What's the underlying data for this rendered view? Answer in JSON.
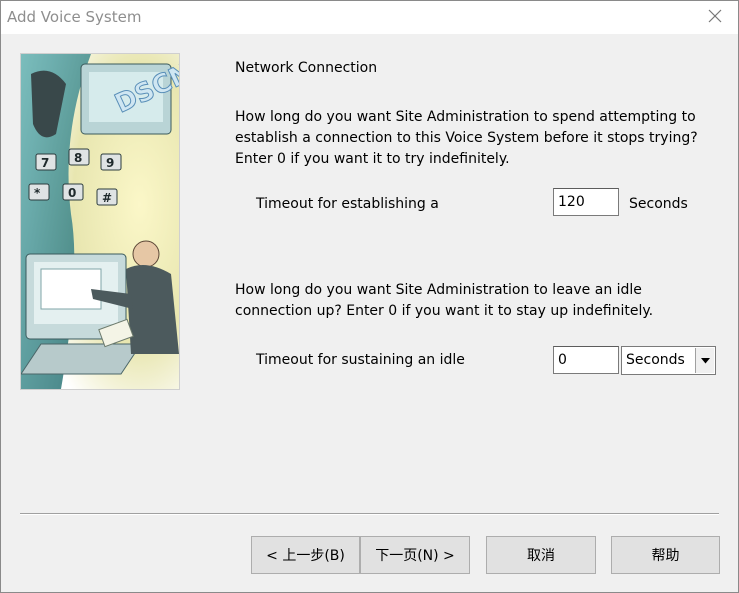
{
  "window": {
    "title": "Add Voice System"
  },
  "page": {
    "heading": "Network Connection",
    "para1": "How long do you want Site Administration to spend attempting to establish a connection to this Voice System before it stops trying?  Enter 0 if you want it to try indefinitely.",
    "timeout_establish": {
      "label": "Timeout for establishing a",
      "value": "120",
      "unit": "Seconds"
    },
    "para2": "How long do you want Site Administration to leave an idle connection up? Enter 0 if you want it to stay up indefinitely.",
    "timeout_idle": {
      "label": "Timeout for sustaining an idle",
      "value": "0",
      "unit_selected": "Seconds"
    }
  },
  "buttons": {
    "back": "< 上一步(B)",
    "next": "下一页(N) >",
    "cancel": "取消",
    "help": "帮助"
  },
  "icons": {
    "close": "close-icon",
    "dropdown": "chevron-down-icon",
    "illustration": "telephony-illustration"
  },
  "colors": {
    "dialog_bg": "#f0f0f0",
    "title_text": "#8e8e8e",
    "button_bg": "#e1e1e1",
    "illustration_teal": "#3f8a8c",
    "illustration_yellow": "#f4eeb0"
  }
}
